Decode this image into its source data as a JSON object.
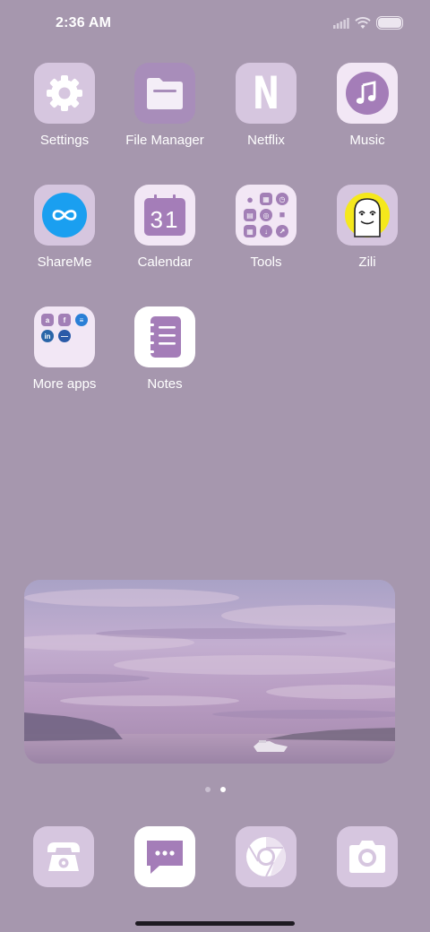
{
  "status_bar": {
    "time": "2:36 AM",
    "battery_level": 1.0
  },
  "apps": [
    {
      "label": "Settings",
      "icon": "gear-icon"
    },
    {
      "label": "File Manager",
      "icon": "folder-icon"
    },
    {
      "label": "Netflix",
      "icon": "netflix-icon"
    },
    {
      "label": "Music",
      "icon": "music-note-icon"
    },
    {
      "label": "ShareMe",
      "icon": "infinity-icon"
    },
    {
      "label": "Calendar",
      "icon": "calendar-icon"
    },
    {
      "label": "Tools",
      "icon": "tools-folder-icon"
    },
    {
      "label": "Zili",
      "icon": "zili-icon"
    },
    {
      "label": "More apps",
      "icon": "apps-folder-icon"
    },
    {
      "label": "Notes",
      "icon": "notes-icon"
    }
  ],
  "calendar_day": "31",
  "netflix_letter": "N",
  "widget": {
    "type": "photo",
    "subject": "sunset-sky-over-sea"
  },
  "pager": {
    "pages": 2,
    "active": 2
  },
  "dock": [
    {
      "name": "phone",
      "icon": "phone-icon"
    },
    {
      "name": "messages",
      "icon": "message-icon"
    },
    {
      "name": "chrome",
      "icon": "chrome-icon"
    },
    {
      "name": "camera",
      "icon": "camera-icon"
    }
  ],
  "colors": {
    "background": "#a697ae",
    "accent": "#a27fb6",
    "tile_light": "#d6c6df",
    "tile_pale": "#f2e7f5",
    "shareme_blue": "#1a9ff0",
    "zili_yellow": "#f5e81c"
  }
}
